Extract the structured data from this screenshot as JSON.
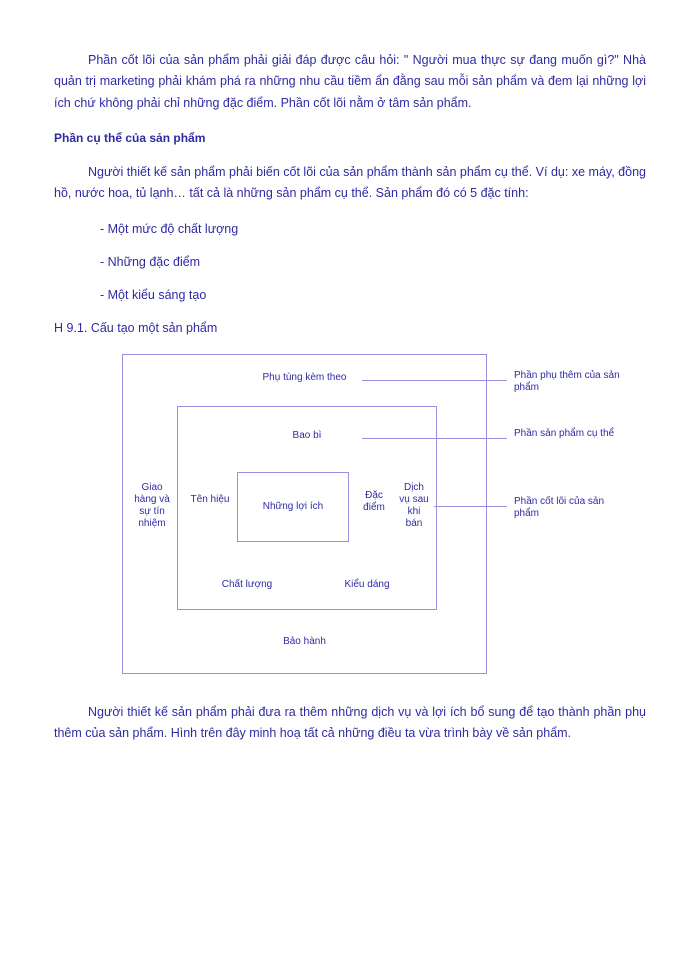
{
  "para1": "Phần cốt lõi của sản phẩm phải giải đáp được câu hỏi:  \" Người mua thực sự đang muốn gì?\" Nhà quản trị marketing phải khám phá ra những nhu cầu tiềm ẩn đằng sau mỗi sản phẩm và đem lại những lợi ích chứ không phải chỉ những đặc điểm. Phần cốt lõi nằm ở tâm sản phẩm.",
  "heading1": "Phần cụ thể của sản phẩm",
  "para2": "Người thiết kế sản phẩm phải biến cốt lõi của sản phẩm thành sản phẩm cụ thể. Ví dụ: xe máy, đồng hồ, nước hoa, tủ lạnh… tất cả là những sản phẩm cụ thể. Sản phẩm đó có 5 đặc tính:",
  "bullet1": "- Một mức độ chất lượng",
  "bullet2": "- Những đặc điểm",
  "bullet3": "- Một kiểu sáng tạo",
  "fig_caption": "H 9.1. Cấu tạo một sản phẩm",
  "diagram": {
    "outer_top": "Phụ tùng kèm theo",
    "outer_left": "Giao hàng và sự tín nhiệm",
    "outer_bottom": "Bảo hành",
    "middle_top": "Bao bì",
    "middle_left": "Tên hiệu",
    "middle_right_top": "Đặc điểm",
    "middle_right_bottom": "Dịch vụ sau khi bán",
    "middle_bottom_left": "Chất lượng",
    "middle_bottom_right": "Kiểu dáng",
    "inner_center": "Những lợi ích",
    "label_outer": "Phần phụ thêm của sản phẩm",
    "label_middle": "Phần sản phẩm cụ thể",
    "label_inner": "Phần cốt lõi của sản phẩm"
  },
  "para3": "Người thiết kế sản phẩm phải đưa ra thêm những dịch vụ và lợi ích bổ sung để tạo thành phần phụ thêm của sản phẩm. Hình trên đây minh hoạ tất cả những điều ta vừa trình bày về sản phẩm."
}
